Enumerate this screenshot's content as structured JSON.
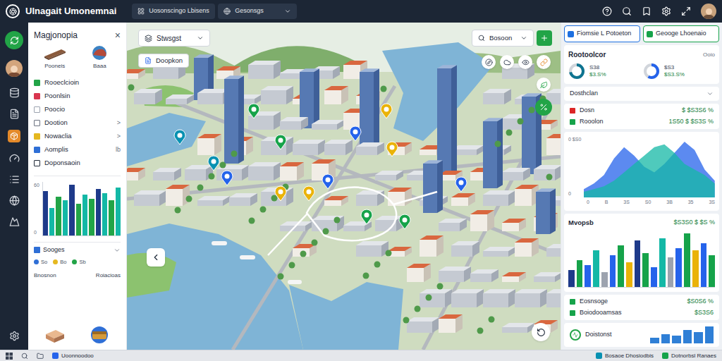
{
  "header": {
    "title": "Ulnagait Umonemnai",
    "field": "Uosonscingo Lbisens",
    "dropdown": "Gesonsgs"
  },
  "left_panel": {
    "title": "Magjonopia",
    "close": "×",
    "thumbs": [
      {
        "label": "Pooneis"
      },
      {
        "label": "Baaa"
      }
    ],
    "layers": [
      {
        "label": "Rooeclcioin",
        "checked": true,
        "color": "#22a447",
        "trail": ""
      },
      {
        "label": "Poonlsin",
        "checked": true,
        "color": "#d9364f",
        "trail": ""
      },
      {
        "label": "Poocio",
        "checked": false,
        "color": "#9ca3af",
        "trail": ""
      },
      {
        "label": "Dootion",
        "checked": false,
        "color": "#6b7280",
        "trail": ">"
      },
      {
        "label": "Nowaclia",
        "checked": true,
        "color": "#e5b820",
        "trail": ">"
      },
      {
        "label": "Aomplis",
        "checked": true,
        "color": "#2f6fd6",
        "trail": "lb"
      },
      {
        "label": "Doponsaoin",
        "checked": false,
        "color": "#1f2937",
        "trail": ""
      }
    ],
    "chart": {
      "ticks": [
        "60",
        "0"
      ],
      "bars": [
        {
          "value": 48,
          "color": "#1e3a8a"
        },
        {
          "value": 30,
          "color": "#14b8a6"
        },
        {
          "value": 42,
          "color": "#22a447"
        },
        {
          "value": 38,
          "color": "#14b8a6"
        },
        {
          "value": 55,
          "color": "#1e3a8a"
        },
        {
          "value": 34,
          "color": "#22a447"
        },
        {
          "value": 44,
          "color": "#14b8a6"
        },
        {
          "value": 40,
          "color": "#22a447"
        },
        {
          "value": 50,
          "color": "#1e3a8a"
        },
        {
          "value": 46,
          "color": "#14b8a6"
        },
        {
          "value": 38,
          "color": "#22a447"
        },
        {
          "value": 52,
          "color": "#14b8a6"
        }
      ]
    },
    "legend": {
      "title": "Sooges",
      "items": [
        {
          "label": "So",
          "color": "#2f6fd6"
        },
        {
          "label": "Bo",
          "color": "#e5b820"
        },
        {
          "label": "Sb",
          "color": "#22a447"
        }
      ]
    },
    "footer_labels": [
      "Bnosnon",
      "Roiacioas"
    ]
  },
  "map": {
    "layer_select": "Stwsgst",
    "button": "Doopkon",
    "search": "Bosoon",
    "pins": [
      {
        "color": "#0891b2"
      },
      {
        "color": "#0891b2"
      },
      {
        "color": "#2563eb"
      },
      {
        "color": "#16a34a"
      },
      {
        "color": "#16a34a"
      },
      {
        "color": "#2563eb"
      },
      {
        "color": "#eab308"
      },
      {
        "color": "#eab308"
      },
      {
        "color": "#eab308"
      },
      {
        "color": "#2563eb"
      },
      {
        "color": "#16a34a"
      },
      {
        "color": "#16a34a"
      },
      {
        "color": "#2563eb"
      },
      {
        "color": "#eab308"
      }
    ]
  },
  "right_panel": {
    "buttons": [
      {
        "label": "Fiomsie L Potoeton",
        "color": "#1d6fe0"
      },
      {
        "label": "Geooge Lhoenaio",
        "color": "#16a34a"
      }
    ],
    "stats": {
      "title": "Rootoolcor",
      "note": "Ooio",
      "items": [
        {
          "label": "S38",
          "value": "$3.S%",
          "level": 0.72,
          "color": "#0e7490"
        },
        {
          "label": "$S3",
          "value": "$S3.S%",
          "level": 0.58,
          "color": "#2563eb"
        }
      ]
    },
    "dropdown": "Dosthclan",
    "rows": [
      {
        "label": "Dosn",
        "value": "$ $S3S6 %",
        "color": "#dc2626"
      },
      {
        "label": "Rooolon",
        "value": "1S50 $ $S3S %",
        "color": "#16a34a"
      }
    ],
    "area_chart": {
      "ticks": [
        "0 $S0",
        "0"
      ],
      "x_labels": [
        "0",
        "B",
        "3S",
        "S0",
        "3B",
        "35",
        "3S"
      ],
      "series": [
        {
          "color": "#2563eb",
          "values": [
            3,
            5,
            8,
            14,
            18,
            15,
            11,
            9,
            12,
            16,
            20,
            17,
            10,
            6
          ]
        },
        {
          "color": "#14b8a6",
          "values": [
            2,
            3,
            4,
            6,
            9,
            12,
            15,
            18,
            19,
            16,
            12,
            10,
            8,
            5
          ]
        }
      ]
    },
    "bar_card": {
      "title": "Mvopsb",
      "value": "$S3S0 $ $S %",
      "bars": [
        {
          "value": 14,
          "color": "#1e3a8a"
        },
        {
          "value": 22,
          "color": "#16a34a"
        },
        {
          "value": 18,
          "color": "#2563eb"
        },
        {
          "value": 30,
          "color": "#14b8a6"
        },
        {
          "value": 12,
          "color": "#9ca3af"
        },
        {
          "value": 26,
          "color": "#2563eb"
        },
        {
          "value": 34,
          "color": "#16a34a"
        },
        {
          "value": 20,
          "color": "#eab308"
        },
        {
          "value": 38,
          "color": "#1e3a8a"
        },
        {
          "value": 28,
          "color": "#16a34a"
        },
        {
          "value": 16,
          "color": "#2563eb"
        },
        {
          "value": 40,
          "color": "#14b8a6"
        },
        {
          "value": 24,
          "color": "#9ca3af"
        },
        {
          "value": 32,
          "color": "#2563eb"
        },
        {
          "value": 44,
          "color": "#16a34a"
        },
        {
          "value": 30,
          "color": "#eab308"
        },
        {
          "value": 36,
          "color": "#2563eb"
        },
        {
          "value": 26,
          "color": "#16a34a"
        }
      ]
    },
    "rows2": [
      {
        "label": "Eosnsoge",
        "value": "$S0S6 %",
        "color": "#16a34a"
      },
      {
        "label": "Boiodooamsas",
        "value": "$S3S6",
        "color": "#16a34a"
      }
    ],
    "bottom_card": {
      "title": "Doistonst",
      "bars": [
        6,
        10,
        8,
        14,
        12,
        18
      ]
    }
  },
  "taskbar": {
    "left": [
      {
        "label": "Uoonnoodoo",
        "color": "#2563eb"
      }
    ],
    "right": [
      {
        "label": "Bosaoe Dhosiodbis",
        "color": "#0891b2"
      },
      {
        "label": "Dotnorbsl Ranaes",
        "color": "#16a34a"
      }
    ]
  }
}
